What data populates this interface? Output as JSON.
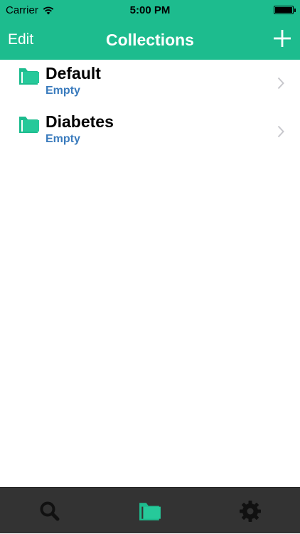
{
  "status_bar": {
    "carrier": "Carrier",
    "time": "5:00 PM"
  },
  "nav": {
    "edit_label": "Edit",
    "title": "Collections",
    "add_icon": "plus-icon"
  },
  "collections": [
    {
      "name": "Default",
      "status": "Empty",
      "icon": "folder-icon"
    },
    {
      "name": "Diabetes",
      "status": "Empty",
      "icon": "folder-icon"
    }
  ],
  "tabbar": {
    "tabs": [
      {
        "icon": "search-icon",
        "active": false
      },
      {
        "icon": "folder-icon",
        "active": true
      },
      {
        "icon": "gear-icon",
        "active": false
      }
    ]
  },
  "colors": {
    "accent": "#1dbc8e",
    "subtext": "#3a7bbd",
    "tabbar_bg": "#333333"
  }
}
